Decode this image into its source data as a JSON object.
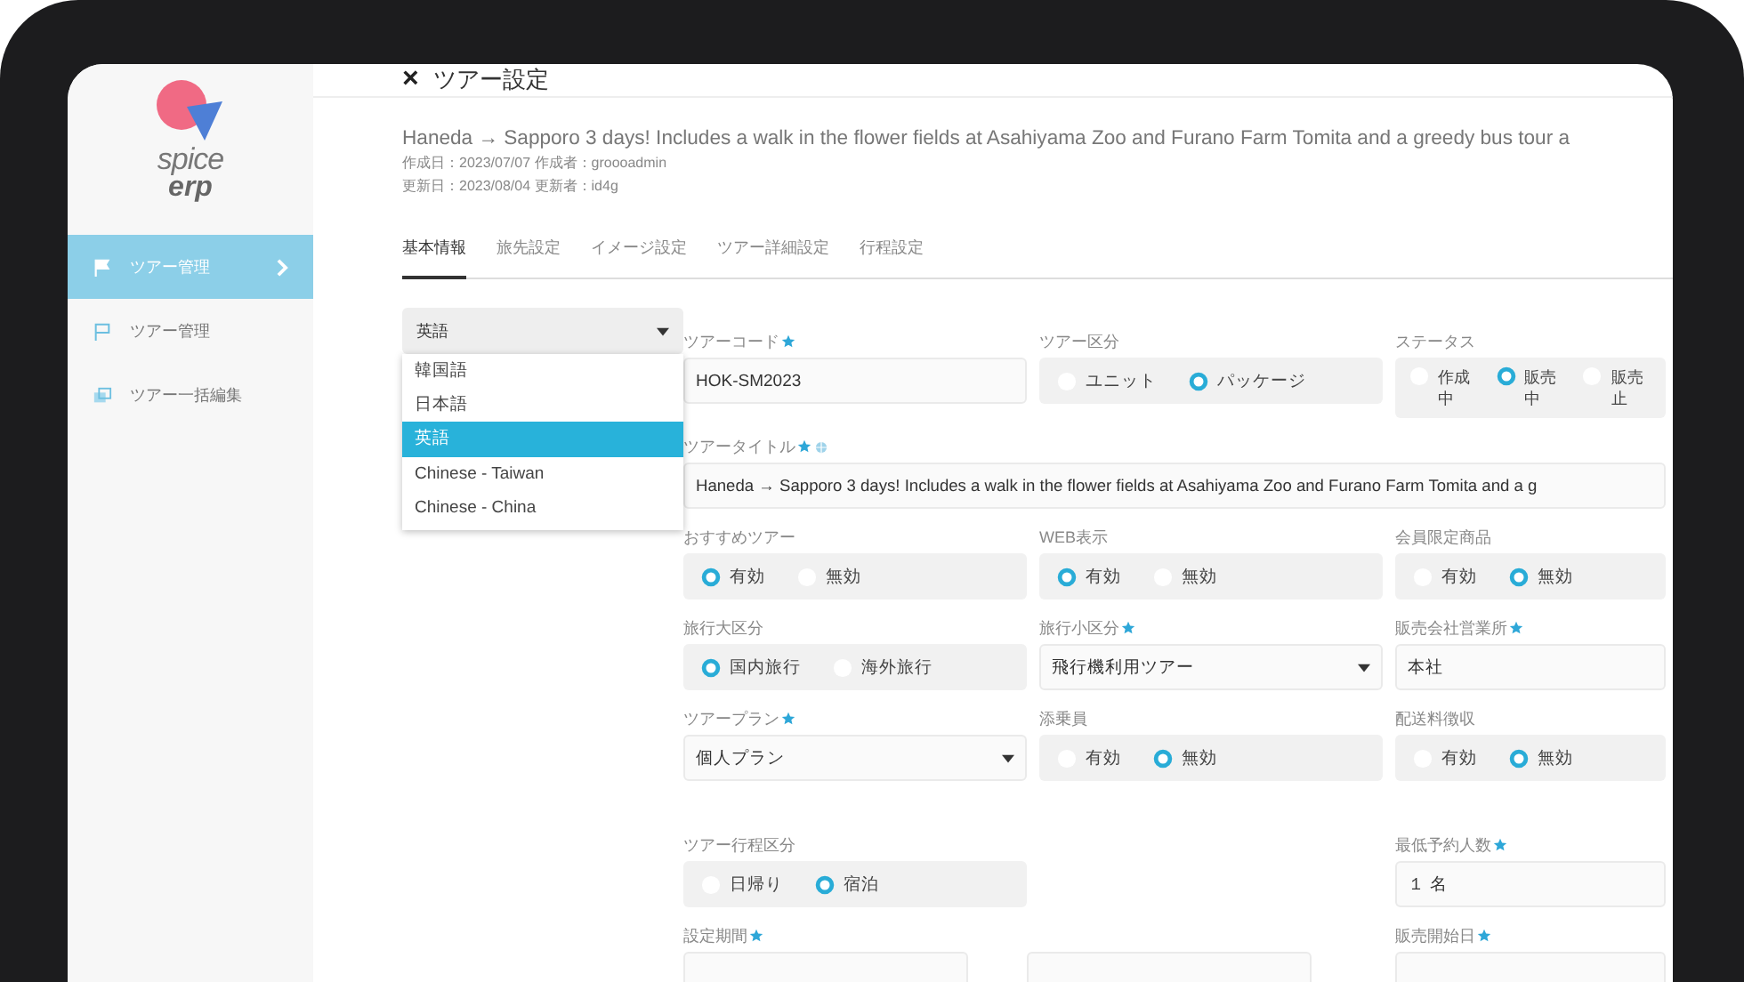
{
  "sidebar": {
    "logo": {
      "line_1": "spice",
      "line_2": "erp"
    },
    "items": [
      {
        "label": "ツアー管理",
        "selected": true,
        "kind": "flag",
        "chevron": true
      },
      {
        "label": "ツアー管理",
        "selected": false,
        "kind": "flag_outline",
        "chevron": false
      },
      {
        "label": "ツアー一括編集",
        "selected": false,
        "kind": "stack",
        "chevron": false
      }
    ]
  },
  "header": {
    "close": "×",
    "title": "ツアー設定"
  },
  "tour": {
    "title": "Haneda → Sapporo 3 days! Includes a walk in the flower fields at Asahiyama Zoo and Furano Farm Tomita and a greedy bus tour a",
    "meta": [
      "作成日：2023/07/07 作成者：groooadmin",
      "更新日：2023/08/04 更新者：id4g"
    ]
  },
  "tabs": [
    {
      "label": "基本情報",
      "selected": true
    },
    {
      "label": "旅先設定",
      "selected": false
    },
    {
      "label": "イメージ設定",
      "selected": false
    },
    {
      "label": "ツアー詳細設定",
      "selected": false
    },
    {
      "label": "行程設定",
      "selected": false
    }
  ],
  "language_select": {
    "value": "英語",
    "expanded": true,
    "options": [
      {
        "label": "韓国語",
        "selected": false
      },
      {
        "label": "日本語",
        "selected": false
      },
      {
        "label": "英語",
        "selected": true
      },
      {
        "label": "Chinese - Taiwan",
        "selected": false
      },
      {
        "label": "Chinese - China",
        "selected": false
      }
    ]
  },
  "form_rows": [
    {
      "fields": [
        {
          "kind": "text",
          "label": "ツアーコード",
          "required": true,
          "value": "HOK-SM2023"
        },
        {
          "kind": "radio",
          "label": "ツアー区分",
          "required": false,
          "options": [
            {
              "label": "ユニット",
              "selected": false
            },
            {
              "label": "パッケージ",
              "selected": true
            }
          ]
        },
        {
          "kind": "radio_wrap",
          "label": "ステータス",
          "required": false,
          "options": [
            {
              "label": "作成中",
              "selected": false
            },
            {
              "label": "販売中",
              "selected": true
            },
            {
              "label": "販売止",
              "selected": false
            }
          ]
        }
      ]
    },
    {
      "fields": [
        {
          "kind": "wide_text",
          "label": "ツアータイトル",
          "required": true,
          "multilingual": true,
          "value": "Haneda → Sapporo 3 days! Includes a walk in the flower fields at Asahiyama Zoo and Furano Farm Tomita and a g"
        }
      ]
    },
    {
      "fields": [
        {
          "kind": "radio",
          "label": "おすすめツアー",
          "required": false,
          "options": [
            {
              "label": "有効",
              "selected": true
            },
            {
              "label": "無効",
              "selected": false
            }
          ]
        },
        {
          "kind": "radio",
          "label": "WEB表示",
          "required": false,
          "options": [
            {
              "label": "有効",
              "selected": true
            },
            {
              "label": "無効",
              "selected": false
            }
          ]
        },
        {
          "kind": "radio",
          "label": "会員限定商品",
          "required": false,
          "options": [
            {
              "label": "有効",
              "selected": false
            },
            {
              "label": "無効",
              "selected": true
            }
          ]
        }
      ]
    },
    {
      "fields": [
        {
          "kind": "radio",
          "label": "旅行大区分",
          "required": false,
          "options": [
            {
              "label": "国内旅行",
              "selected": true
            },
            {
              "label": "海外旅行",
              "selected": false
            }
          ]
        },
        {
          "kind": "select",
          "label": "旅行小区分",
          "required": true,
          "value": "飛行機利用ツアー"
        },
        {
          "kind": "text",
          "label": "販売会社営業所",
          "required": true,
          "value": "本社"
        }
      ]
    },
    {
      "fields": [
        {
          "kind": "select",
          "label": "ツアープラン",
          "required": true,
          "value": "個人プラン"
        },
        {
          "kind": "radio",
          "label": "添乗員",
          "required": false,
          "options": [
            {
              "label": "有効",
              "selected": false
            },
            {
              "label": "無効",
              "selected": true
            }
          ]
        },
        {
          "kind": "radio",
          "label": "配送料徴収",
          "required": false,
          "options": [
            {
              "label": "有効",
              "selected": false
            },
            {
              "label": "無効",
              "selected": true
            }
          ]
        }
      ]
    },
    {
      "fields": [
        {
          "kind": "radio",
          "label": "ツアー行程区分",
          "required": false,
          "options": [
            {
              "label": "日帰り",
              "selected": false
            },
            {
              "label": "宿泊",
              "selected": true
            }
          ]
        },
        {
          "kind": "gap"
        },
        {
          "kind": "text",
          "label": "最低予約人数",
          "required": true,
          "value": "１ 名"
        }
      ]
    },
    {
      "fields": [
        {
          "kind": "date_range",
          "label": "設定期間",
          "required": true
        },
        {
          "kind": "text",
          "label": "販売開始日",
          "required": true
        }
      ]
    }
  ]
}
